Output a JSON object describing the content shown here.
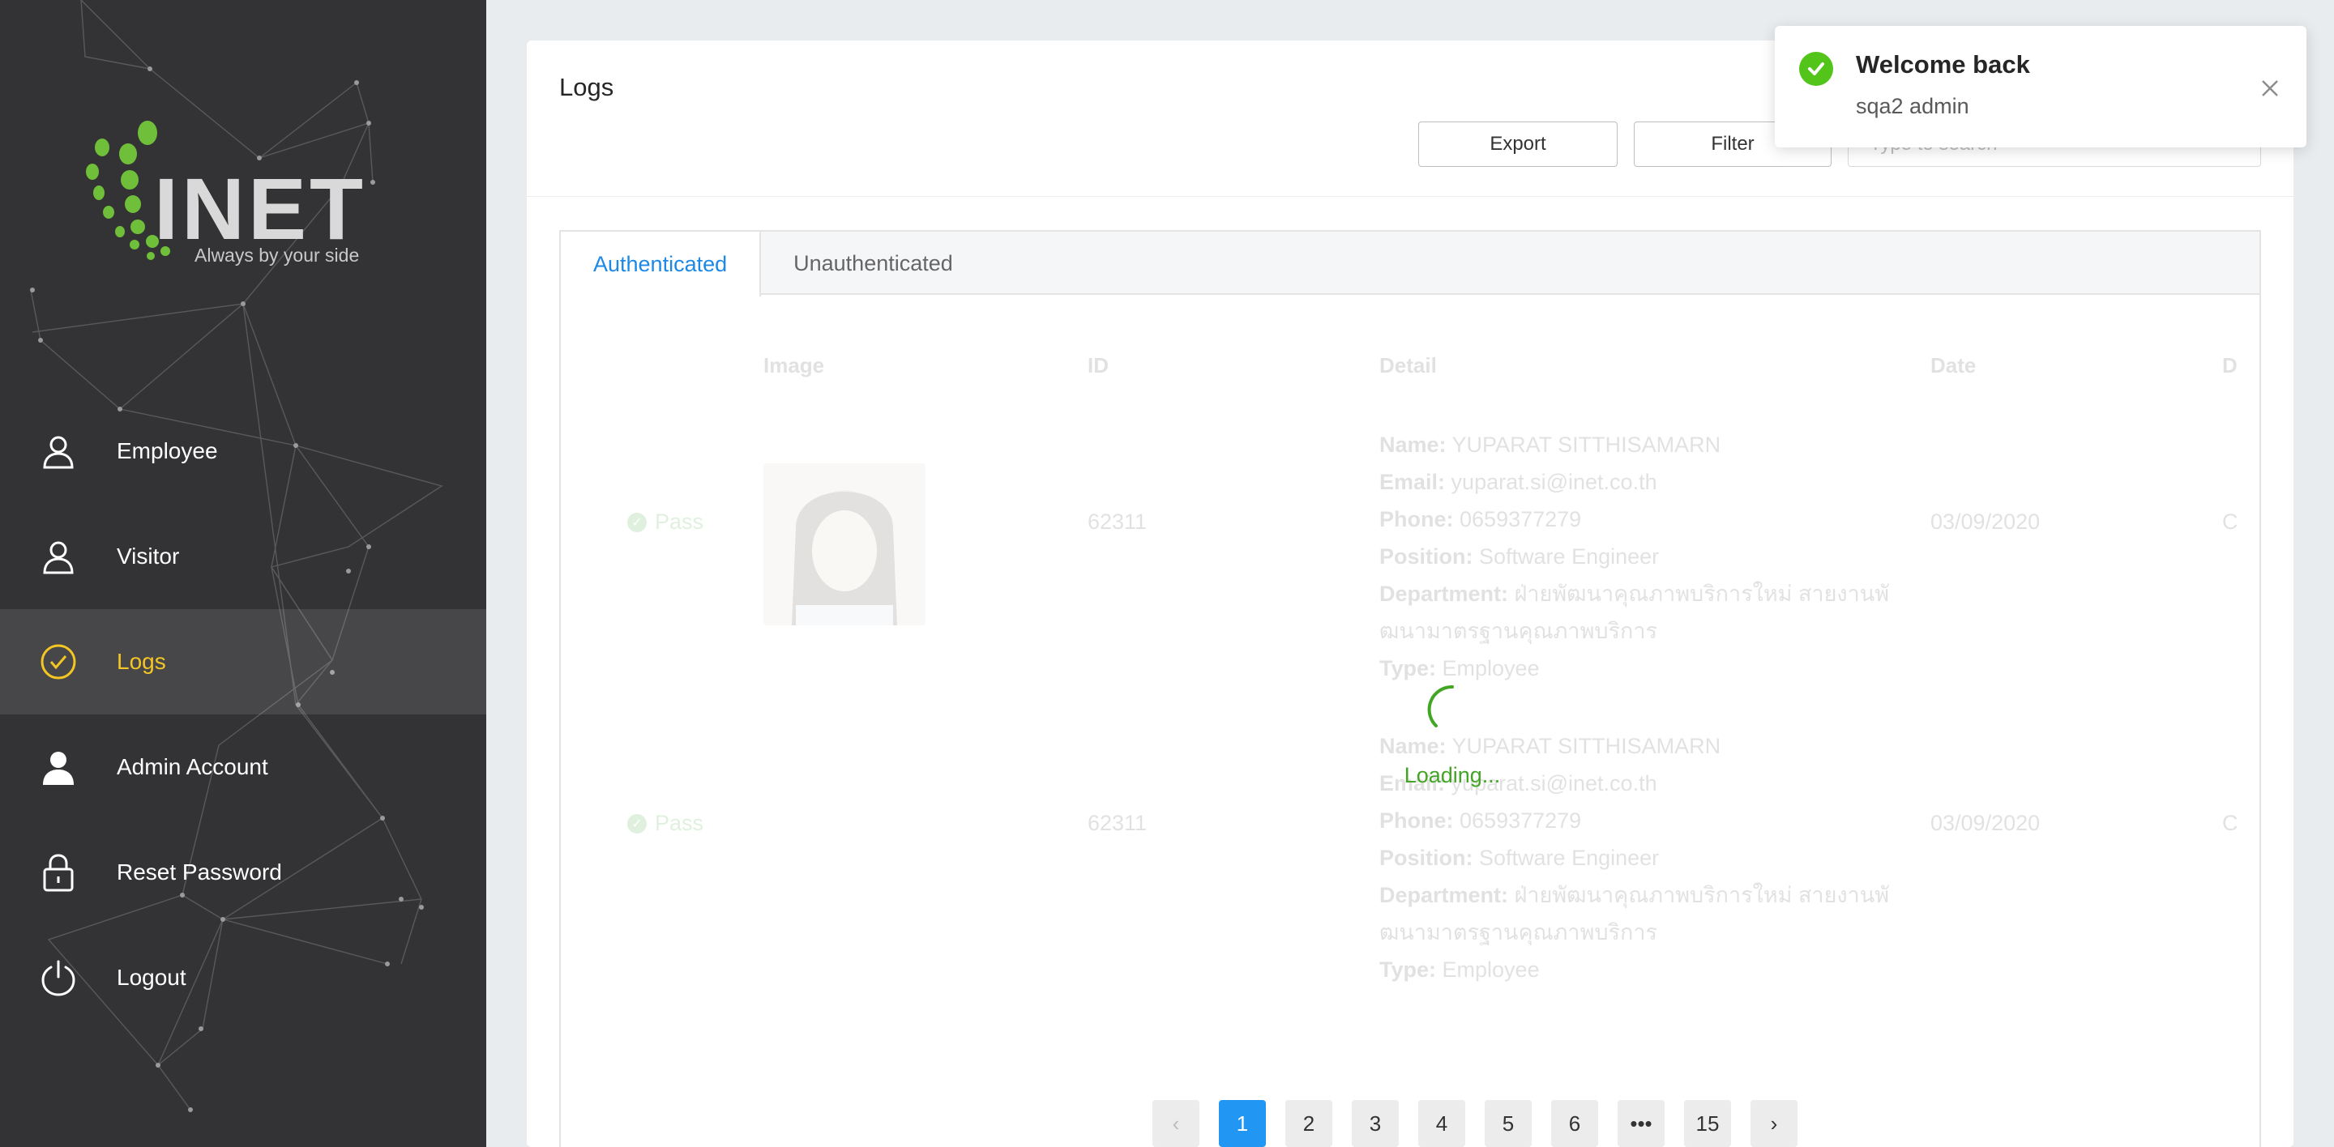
{
  "brand": {
    "name": "INET",
    "tagline": "Always by your side"
  },
  "nav": {
    "items": [
      {
        "label": "Employee",
        "icon": "user-icon"
      },
      {
        "label": "Visitor",
        "icon": "user-icon"
      },
      {
        "label": "Logs",
        "icon": "check-circle-icon",
        "active": true
      },
      {
        "label": "Admin Account",
        "icon": "user-filled-icon"
      },
      {
        "label": "Reset Password",
        "icon": "lock-icon"
      },
      {
        "label": "Logout",
        "icon": "power-icon"
      }
    ],
    "active_color": "#f3c623"
  },
  "page": {
    "title": "Logs",
    "export_label": "Export",
    "filter_label": "Filter",
    "search_placeholder": "Type to search"
  },
  "tabs": [
    "Authenticated",
    "Unauthenticated"
  ],
  "table": {
    "columns": [
      "Image",
      "ID",
      "Detail",
      "Date",
      "D"
    ],
    "rows": [
      {
        "status": "Pass",
        "id": "62311",
        "name": "YUPARAT SITTHISAMARN",
        "email": "yuparat.si@inet.co.th",
        "phone": "0659377279",
        "position": "Software Engineer",
        "department_1": "ฝ่ายพัฒนาคุณภาพบริการใหม่ สายงานพั",
        "department_2": "ฒนามาตรฐานคุณภาพบริการ",
        "type": "Employee",
        "date": "03/09/2020",
        "extra": "C"
      },
      {
        "status": "Pass",
        "id": "62311",
        "name": "YUPARAT SITTHISAMARN",
        "email": "yuparat.si@inet.co.th",
        "phone": "0659377279",
        "position": "Software Engineer",
        "department_1": "ฝ่ายพัฒนาคุณภาพบริการใหม่ สายงานพั",
        "department_2": "ฒนามาตรฐานคุณภาพบริการ",
        "type": "Employee",
        "date": "03/09/2020",
        "extra": "C"
      }
    ],
    "field_labels": {
      "name": "Name:",
      "email": "Email:",
      "phone": "Phone:",
      "position": "Position:",
      "department": "Department:",
      "type": "Type:"
    }
  },
  "loading_text": "Loading...",
  "pagination": {
    "prev": "‹",
    "pages": [
      "1",
      "2",
      "3",
      "4",
      "5",
      "6",
      "•••",
      "15"
    ],
    "next": "›",
    "current": "1"
  },
  "toast": {
    "title": "Welcome back",
    "message": "sqa2 admin"
  },
  "colors": {
    "sidebar": "#333335",
    "accent_blue": "#2196f3",
    "success": "#52c41a"
  }
}
